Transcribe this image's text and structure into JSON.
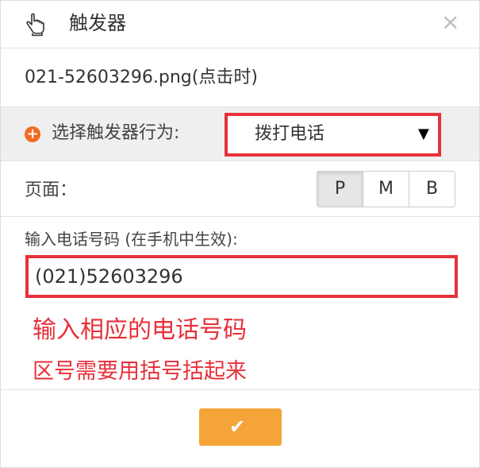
{
  "dialog": {
    "title": "触发器",
    "close_glyph": "×",
    "hand_icon": "pointer-hand-icon"
  },
  "image": {
    "filename": "021-52603296.png(点击时)"
  },
  "behavior": {
    "label": "选择触发器行为:",
    "selected": "拨打电话",
    "arrow": "▼",
    "highlight_color": "#e8303a",
    "plus_color": "#f26a21"
  },
  "page": {
    "label": "页面：",
    "options": [
      "P",
      "M",
      "B"
    ],
    "selected": "P"
  },
  "phone": {
    "label": "输入电话号码 (在手机中生效):",
    "value": "(021)52603296"
  },
  "notes": {
    "line1": "输入相应的电话号码",
    "line2": "区号需要用括号括起来",
    "color": "#e8303a"
  },
  "confirm": {
    "glyph": "✔",
    "color": "#f5a43a"
  }
}
